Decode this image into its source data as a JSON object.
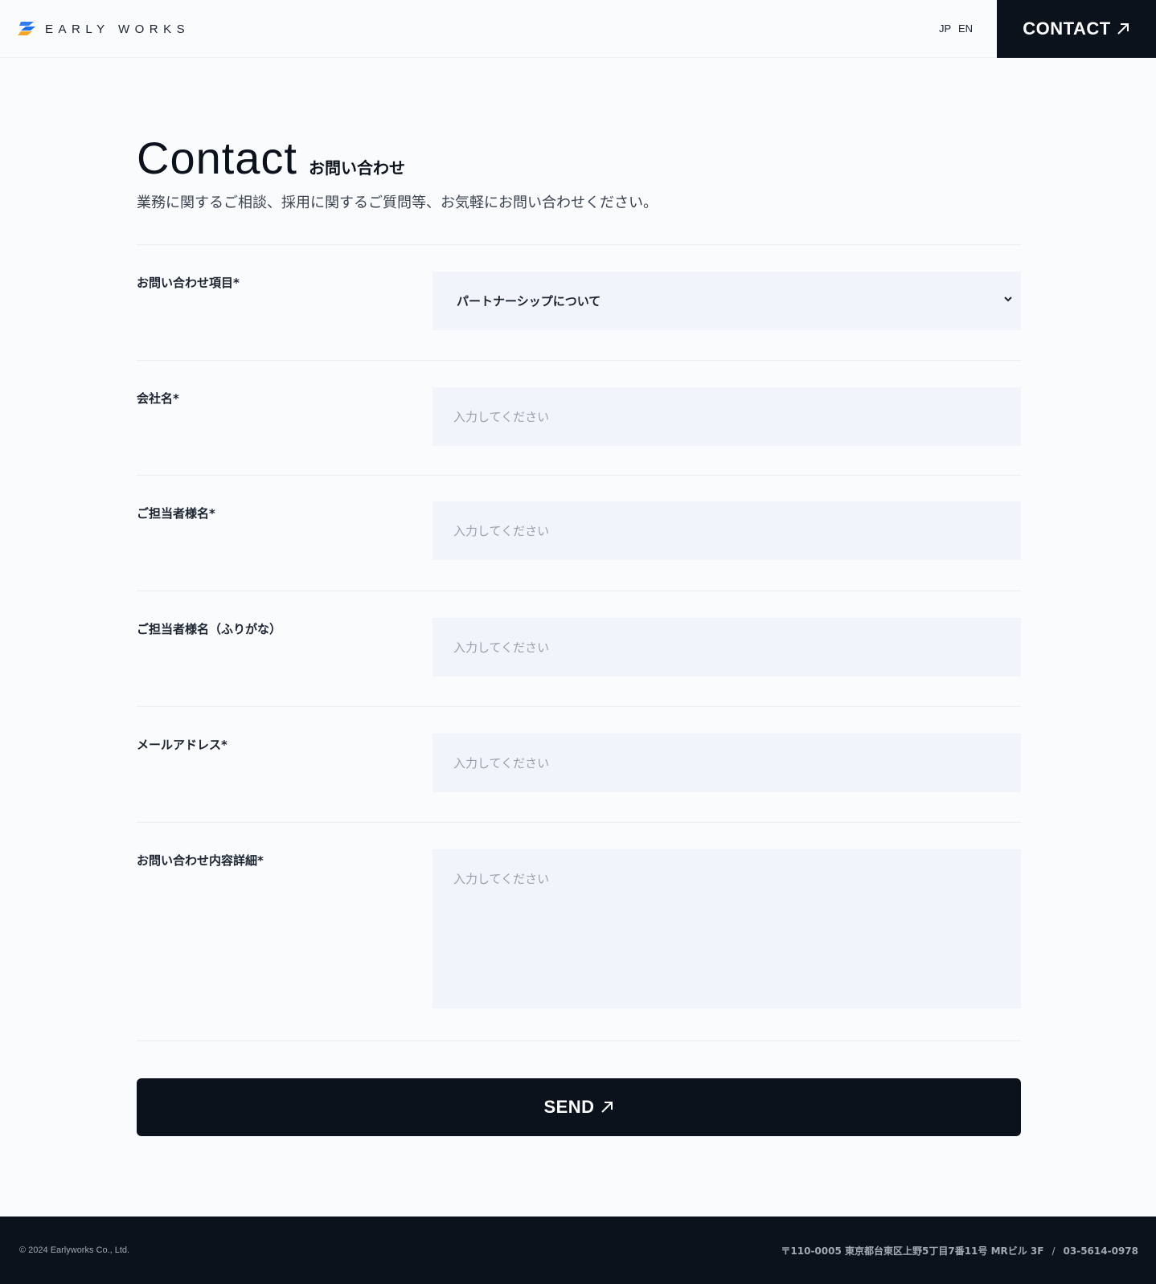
{
  "header": {
    "logo_text": "EARLY WORKS",
    "lang_jp": "JP",
    "lang_en": "EN",
    "contact_label": "CONTACT",
    "arrow_icon": "arrow-up-right-icon"
  },
  "page": {
    "title_en": "Contact",
    "title_ja": "お問い合わせ",
    "lead": "業務に関するご相談、採用に関するご質問等、お気軽にお問い合わせください。"
  },
  "form": {
    "inquiry_type": {
      "label": "お問い合わせ項目*",
      "value": "パートナーシップについて"
    },
    "company": {
      "label": "会社名*",
      "placeholder": "入力してください"
    },
    "name": {
      "label": "ご担当者様名*",
      "placeholder": "入力してください"
    },
    "name_kana": {
      "label": "ご担当者様名（ふりがな）",
      "placeholder": "入力してください"
    },
    "email": {
      "label": "メールアドレス*",
      "placeholder": "入力してください"
    },
    "details": {
      "label": "お問い合わせ内容詳細*",
      "placeholder": "入力してください"
    },
    "send_label": "SEND"
  },
  "footer": {
    "copyright": "© 2024 Earlyworks Co., Ltd.",
    "address": "〒110-0005 東京都台東区上野5丁目7番11号 MRビル 3F",
    "separator": "/",
    "phone": "03-5614-0978"
  },
  "colors": {
    "dark": "#0b121c",
    "field_bg": "#f1f4fa",
    "page_bg": "#fafbfd",
    "logo_blue": "#2f7cf6",
    "logo_orange": "#f5a623"
  }
}
